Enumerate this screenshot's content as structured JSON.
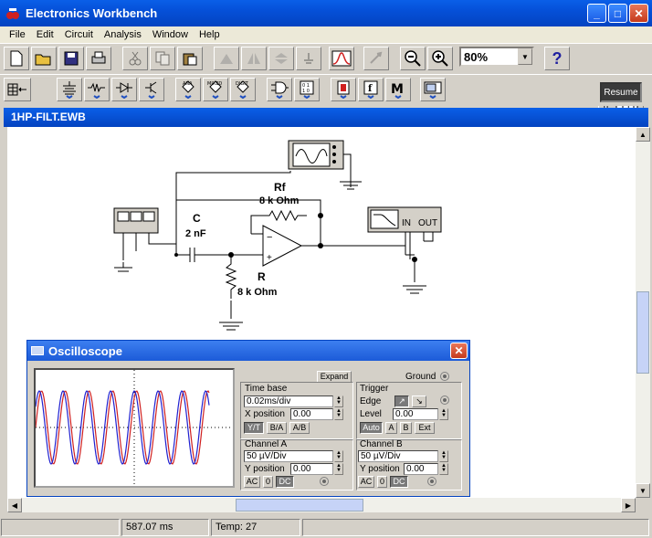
{
  "window": {
    "title": "Electronics Workbench"
  },
  "menu": [
    "File",
    "Edit",
    "Circuit",
    "Analysis",
    "Window",
    "Help"
  ],
  "toolbar": {
    "zoom": "80%",
    "help": "?",
    "resume": "Resume",
    "power_label": "I"
  },
  "document": {
    "title": "1HP-FILT.EWB"
  },
  "circuit": {
    "capacitor_name": "C",
    "capacitor_value": "2 nF",
    "resistor_name": "R",
    "resistor_value": "8 k Ohm",
    "feedback_name": "Rf",
    "feedback_value": "8 k Ohm",
    "plotter_in": "IN",
    "plotter_out": "OUT"
  },
  "oscilloscope": {
    "title": "Oscilloscope",
    "expand": "Expand",
    "ground": "Ground",
    "timebase": {
      "label": "Time base",
      "value": "0.02ms/div",
      "xpos_label": "X position",
      "xpos": "0.00",
      "modes": [
        "Y/T",
        "B/A",
        "A/B"
      ]
    },
    "trigger": {
      "label": "Trigger",
      "edge_label": "Edge",
      "level_label": "Level",
      "level": "0.00",
      "modes": [
        "Auto",
        "A",
        "B",
        "Ext"
      ]
    },
    "channel_a": {
      "label": "Channel A",
      "value": "50 µV/Div",
      "ypos_label": "Y position",
      "ypos": "0.00",
      "coupling": [
        "AC",
        "0",
        "DC"
      ]
    },
    "channel_b": {
      "label": "Channel B",
      "value": "50 µV/Div",
      "ypos_label": "Y position",
      "ypos": "0.00",
      "coupling": [
        "AC",
        "0",
        "DC"
      ]
    }
  },
  "status": {
    "time": "587.07 ms",
    "temp": "Temp:  27"
  }
}
